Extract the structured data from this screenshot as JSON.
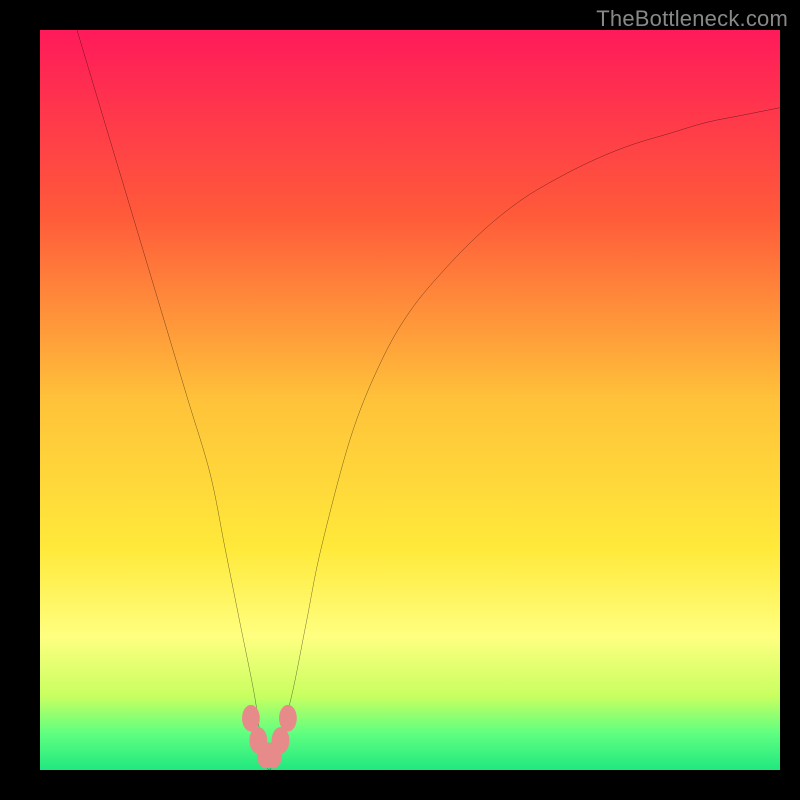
{
  "watermark": "TheBottleneck.com",
  "chart_data": {
    "type": "line",
    "title": "",
    "xlabel": "",
    "ylabel": "",
    "xlim": [
      0,
      100
    ],
    "ylim": [
      0,
      100
    ],
    "grid": false,
    "legend": false,
    "background_gradient": {
      "stops": [
        {
          "offset": 0.0,
          "color": "#ff1a5a"
        },
        {
          "offset": 0.25,
          "color": "#ff5a3a"
        },
        {
          "offset": 0.5,
          "color": "#ffc23a"
        },
        {
          "offset": 0.7,
          "color": "#ffe93a"
        },
        {
          "offset": 0.82,
          "color": "#ffff80"
        },
        {
          "offset": 0.9,
          "color": "#c8ff60"
        },
        {
          "offset": 0.95,
          "color": "#60ff80"
        },
        {
          "offset": 1.0,
          "color": "#20e880"
        }
      ]
    },
    "series": [
      {
        "name": "curve",
        "color": "#000000",
        "x": [
          5,
          8,
          11,
          14,
          17,
          20,
          23,
          25,
          27,
          29,
          30,
          31,
          32,
          34,
          36,
          38,
          42,
          46,
          50,
          55,
          60,
          65,
          70,
          75,
          80,
          85,
          90,
          95,
          100
        ],
        "values": [
          100,
          90,
          80,
          70,
          60,
          50,
          40,
          30,
          20,
          10,
          3,
          0,
          3,
          10,
          20,
          30,
          45,
          55,
          62,
          68,
          73,
          77,
          80,
          82.5,
          84.5,
          86,
          87.5,
          88.5,
          89.5
        ]
      }
    ],
    "markers": {
      "name": "bump-markers",
      "color": "#e68a8a",
      "points": [
        {
          "x": 28.5,
          "y": 7
        },
        {
          "x": 29.5,
          "y": 4
        },
        {
          "x": 30.5,
          "y": 2
        },
        {
          "x": 31.5,
          "y": 2
        },
        {
          "x": 32.5,
          "y": 4
        },
        {
          "x": 33.5,
          "y": 7
        }
      ],
      "rx": 1.2,
      "ry": 1.8
    }
  }
}
